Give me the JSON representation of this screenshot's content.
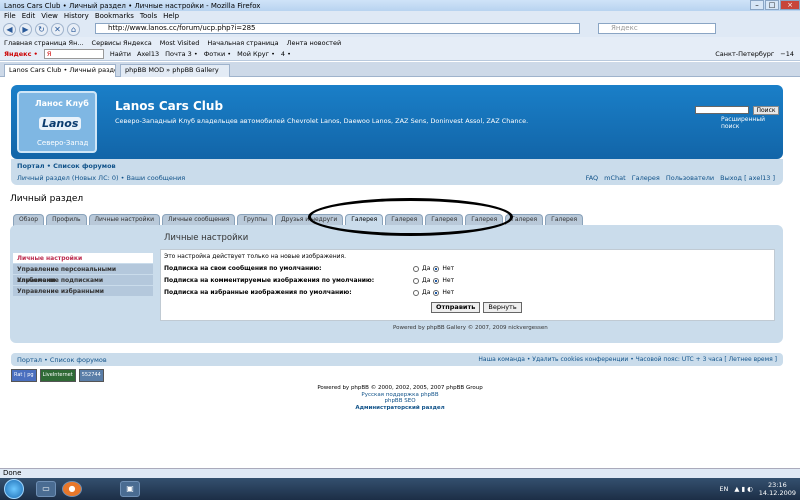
{
  "window": {
    "title": "Lanos Cars Club • Личный раздел • Личные настройки - Mozilla Firefox",
    "controls": [
      "–",
      "□",
      "×"
    ]
  },
  "menu": [
    "File",
    "Edit",
    "View",
    "History",
    "Bookmarks",
    "Tools",
    "Help"
  ],
  "nav": {
    "url": "http://www.lanos.cc/forum/ucp.php?i=285",
    "search_placeholder": "Яндекс"
  },
  "bookmarks": [
    "Главная страница Ян...",
    "Сервисы Яндекса",
    "Most Visited",
    "Начальная страница",
    "Лента новостей"
  ],
  "yandexbar": {
    "items": [
      "Яндекс •",
      "Я",
      "Найти",
      "Axel13",
      "Почта 3 •",
      "Фотки •",
      "Мой Круг •",
      "4 •"
    ],
    "city": "Санкт-Петербург",
    "temp": "−14"
  },
  "tabs": [
    {
      "label": "Lanos Cars Club • Личный раздел • Ли..."
    },
    {
      "label": "phpBB MOD » phpBB Gallery"
    }
  ],
  "forum": {
    "logo": {
      "top": "Ланос Клуб",
      "mid": "Lanos",
      "bottom": "Северо-Запад"
    },
    "site_name": "Lanos Cars Club",
    "site_desc": "Северо-Западный Клуб владельцев автомобилей Chevrolet Lanos, Daewoo Lanos, ZAZ Sens, Doninvest Assol, ZAZ Chance.",
    "search_button": "Поиск",
    "adv_search": "Расширенный поиск",
    "breadcrumb": "Портал • Список форумов",
    "ucp_link": "Личный раздел (Новых ЛС: 0) • Ваши сообщения",
    "right_links": [
      "FAQ",
      "mChat",
      "Галерея",
      "Пользователи",
      "Выход [ axel13 ]"
    ],
    "page_title": "Личный раздел",
    "ftabs": [
      "Обзор",
      "Профиль",
      "Личные настройки",
      "Личные сообщения",
      "Группы",
      "Друзья и недруги",
      "Галерея",
      "Галерея",
      "Галерея",
      "Галерея",
      "Галерея",
      "Галерея"
    ],
    "left_menu": [
      "Личные настройки",
      "Управление персональными альбомами",
      "Управление подписками",
      "Управление избранными"
    ],
    "settings_title": "Личные настройки",
    "note": "Это настройка действует только на новые изображения.",
    "rows": [
      {
        "label": "Подписка на свои сообщения по умолчанию:",
        "yes": "Да",
        "no": "Нет"
      },
      {
        "label": "Подписка на комментируемые изображения по умолчанию:",
        "yes": "Да",
        "no": "Нет"
      },
      {
        "label": "Подписка на избранные изображения по умолчанию:",
        "yes": "Да",
        "no": "Нет"
      }
    ],
    "submit": "Отправить",
    "reset": "Вернуть",
    "powered_gallery": "Powered by phpBB Gallery © 2007, 2009 nickvergessen",
    "bottom_crumbs": "Портал • Список форумов",
    "bottom_right": "Наша команда • Удалить cookies конференции • Часовой пояс: UTC + 3 часа [ Летнее время ]",
    "counters": [
      "Rat | pg",
      "LiveInternet",
      "552744"
    ],
    "credits": [
      "Powered by phpBB © 2000, 2002, 2005, 2007 phpBB Group",
      "Русская поддержка phpBB",
      "phpBB SEO",
      "Администраторский раздел"
    ]
  },
  "statusbar": "Done",
  "taskbar": {
    "lang": "EN",
    "time": "23:16",
    "date": "14.12.2009"
  }
}
